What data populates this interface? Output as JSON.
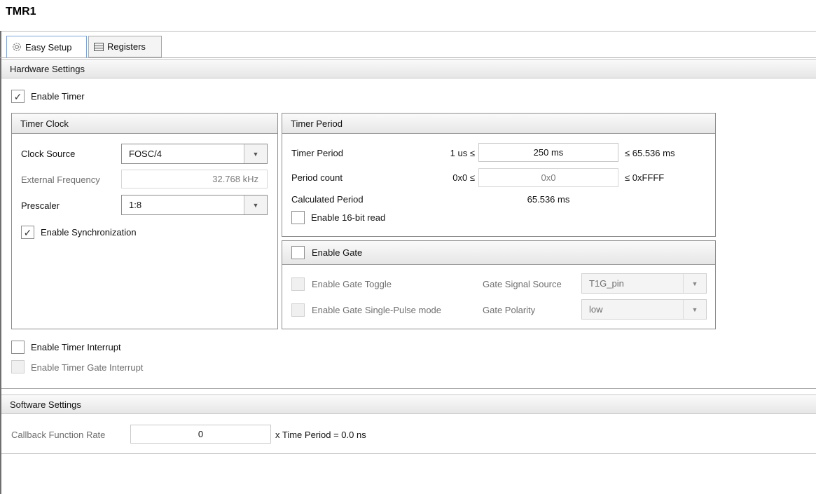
{
  "window": {
    "title": "TMR1"
  },
  "tabs": [
    {
      "label": "Easy Setup",
      "icon": "gear-icon",
      "active": true
    },
    {
      "label": "Registers",
      "icon": "registers-icon",
      "active": false
    }
  ],
  "hardware": {
    "title": "Hardware Settings",
    "enable_timer": {
      "label": "Enable Timer",
      "checked": true
    },
    "timer_clock": {
      "title": "Timer Clock",
      "clock_source": {
        "label": "Clock Source",
        "value": "FOSC/4"
      },
      "external_frequency": {
        "label": "External Frequency",
        "value": "32.768 kHz"
      },
      "prescaler": {
        "label": "Prescaler",
        "value": "1:8"
      },
      "enable_sync": {
        "label": "Enable Synchronization",
        "checked": true
      }
    },
    "timer_period": {
      "title": "Timer Period",
      "period": {
        "label": "Timer Period",
        "min": "1 us ≤",
        "value": "250 ms",
        "max": "≤ 65.536 ms"
      },
      "count": {
        "label": "Period count",
        "min": "0x0 ≤",
        "value": "0x0",
        "max": "≤ 0xFFFF"
      },
      "calculated": {
        "label": "Calculated Period",
        "value": "65.536 ms"
      },
      "enable_16bit": {
        "label": "Enable 16-bit read",
        "checked": false
      }
    },
    "gate": {
      "title": "Enable Gate",
      "toggle": {
        "label": "Enable Gate Toggle"
      },
      "single_pulse": {
        "label": "Enable Gate Single-Pulse mode"
      },
      "signal_source": {
        "label": "Gate Signal Source",
        "value": "T1G_pin"
      },
      "polarity": {
        "label": "Gate Polarity",
        "value": "low"
      }
    },
    "timer_interrupt": {
      "label": "Enable Timer Interrupt"
    },
    "gate_interrupt": {
      "label": "Enable Timer Gate Interrupt"
    }
  },
  "software": {
    "title": "Software Settings",
    "callback_rate": {
      "label": "Callback Function Rate",
      "value": "0",
      "suffix": "x Time Period = 0.0 ns"
    }
  },
  "glyphs": {
    "check": "✓",
    "dropdown": "▼"
  },
  "colors": {
    "tab_active_border": "#7ea4d9",
    "group_border": "#8d8d8d",
    "header_gradient_bottom": "#e6e6e6"
  }
}
